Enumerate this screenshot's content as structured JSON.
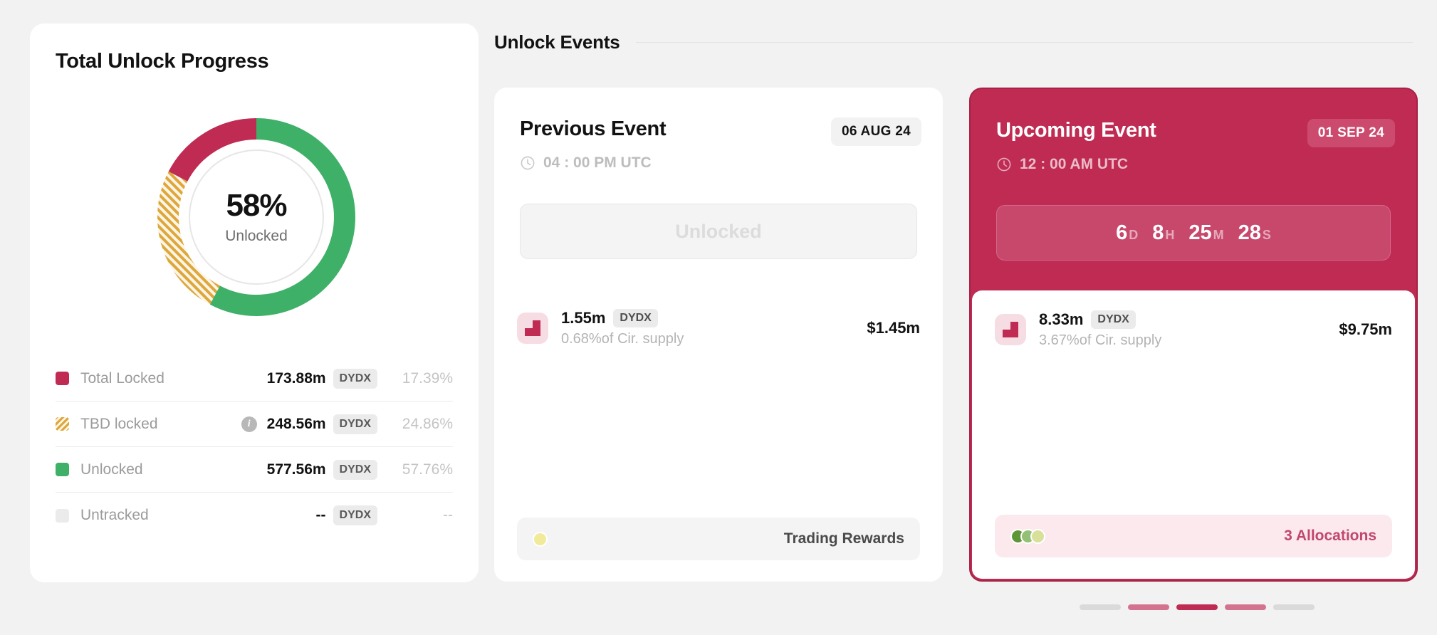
{
  "progress": {
    "title": "Total Unlock Progress",
    "donut": {
      "percent_label": "58%",
      "sub_label": "Unlocked"
    },
    "legend": [
      {
        "label": "Total Locked",
        "amount": "173.88m",
        "ticker": "DYDX",
        "percent": "17.39%",
        "swatch": "locked-swatch",
        "has_info": false
      },
      {
        "label": "TBD locked",
        "amount": "248.56m",
        "ticker": "DYDX",
        "percent": "24.86%",
        "swatch": "tbd-swatch",
        "has_info": true
      },
      {
        "label": "Unlocked",
        "amount": "577.56m",
        "ticker": "DYDX",
        "percent": "57.76%",
        "swatch": "unlocked-swatch",
        "has_info": false
      },
      {
        "label": "Untracked",
        "amount": "--",
        "ticker": "DYDX",
        "percent": "--",
        "swatch": "untracked-swatch",
        "has_info": false
      }
    ]
  },
  "events": {
    "section_title": "Unlock Events",
    "previous": {
      "title": "Previous Event",
      "date": "06 AUG 24",
      "time": "04 : 00 PM UTC",
      "status": "Unlocked",
      "token": {
        "amount": "1.55m",
        "ticker": "DYDX",
        "supply_share": "0.68%of Cir. supply",
        "usd_value": "$1.45m"
      },
      "footer_label": "Trading Rewards"
    },
    "upcoming": {
      "title": "Upcoming Event",
      "date": "01 SEP 24",
      "time": "12 : 00 AM UTC",
      "countdown": [
        {
          "value": "6",
          "unit": "D"
        },
        {
          "value": "8",
          "unit": "H"
        },
        {
          "value": "25",
          "unit": "M"
        },
        {
          "value": "28",
          "unit": "S"
        }
      ],
      "token": {
        "amount": "8.33m",
        "ticker": "DYDX",
        "supply_share": "3.67%of Cir. supply",
        "usd_value": "$9.75m"
      },
      "footer_label": "3 Allocations"
    }
  },
  "pagination": {
    "bars": [
      "#dadada",
      "#d4738f",
      "#bf2b52",
      "#d4738f",
      "#dadada"
    ]
  },
  "chart_data": {
    "type": "pie",
    "title": "Total Unlock Progress",
    "categories": [
      "Total Locked",
      "TBD locked",
      "Unlocked",
      "Untracked"
    ],
    "values": [
      17.39,
      24.86,
      57.76,
      0
    ],
    "raw_values": [
      "173.88m",
      "248.56m",
      "577.56m",
      "--"
    ],
    "unit": "DYDX",
    "colors": [
      "#bf2b52",
      "#dda73c",
      "#3fb067",
      "#ebebeb"
    ],
    "center_label": "58%",
    "center_sublabel": "Unlocked",
    "legend": "bottom"
  },
  "colors": {
    "brand": "#bf2b52",
    "locked": "#bf2b52",
    "tbd": "#dda73c",
    "unlocked": "#3fb067",
    "untracked": "#ebebeb",
    "page_background": "#f2f2f2",
    "reward_dot": "#f2ea9b",
    "alloc_dots": [
      "#5d9636",
      "#93c074",
      "#d8e09a"
    ]
  }
}
